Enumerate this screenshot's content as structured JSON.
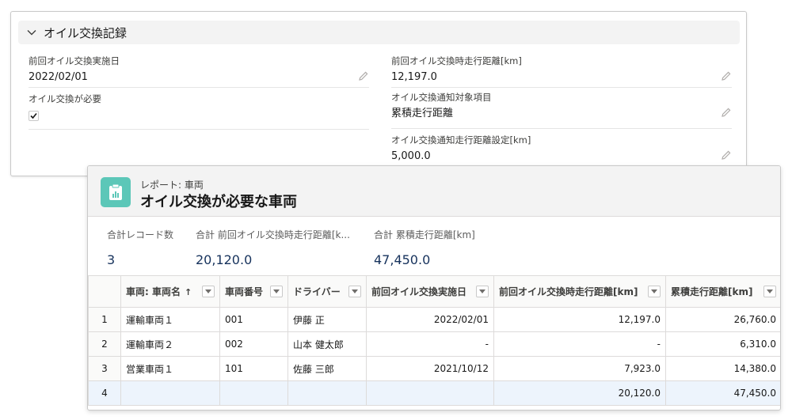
{
  "record": {
    "section_title": "オイル交換記録",
    "fields": {
      "last_oil_change_date_label": "前回オイル交換実施日",
      "last_oil_change_date_value": "2022/02/01",
      "last_oil_change_mileage_label": "前回オイル交換時走行距離[km]",
      "last_oil_change_mileage_value": "12,197.0",
      "oil_change_needed_label": "オイル交換が必要",
      "oil_change_needed_checked": true,
      "notify_target_label": "オイル交換通知対象項目",
      "notify_target_value": "累積走行距離",
      "notify_distance_label": "オイル交換通知走行距離設定[km]",
      "notify_distance_value": "5,000.0"
    }
  },
  "report": {
    "subtitle": "レポート: 車両",
    "title": "オイル交換が必要な車両",
    "icon": "report-clipboard-icon",
    "accent_color": "#5cc7b8",
    "summary": [
      {
        "label": "合計レコード数",
        "value": "3"
      },
      {
        "label": "合計 前回オイル交換時走行距離[k...",
        "value": "20,120.0"
      },
      {
        "label": "合計 累積走行距離[km]",
        "value": "47,450.0"
      }
    ],
    "columns": [
      "車両: 車両名",
      "車両番号",
      "ドライバー",
      "前回オイル交換実施日",
      "前回オイル交換時走行距離[km]",
      "累積走行距離[km]"
    ],
    "sort_indicator": "↑",
    "rows": [
      {
        "num": "1",
        "name": "運輸車両１",
        "vehicle_no": "001",
        "driver": "伊藤 正",
        "date": "2022/02/01",
        "mileage": "12,197.0",
        "total": "26,760.0"
      },
      {
        "num": "2",
        "name": "運輸車両２",
        "vehicle_no": "002",
        "driver": "山本 健太郎",
        "date": "-",
        "mileage": "-",
        "total": "6,310.0"
      },
      {
        "num": "3",
        "name": "営業車両１",
        "vehicle_no": "101",
        "driver": "佐藤 三郎",
        "date": "2021/10/12",
        "mileage": "7,923.0",
        "total": "14,380.0"
      }
    ],
    "total_row": {
      "num": "4",
      "mileage": "20,120.0",
      "total": "47,450.0"
    }
  }
}
